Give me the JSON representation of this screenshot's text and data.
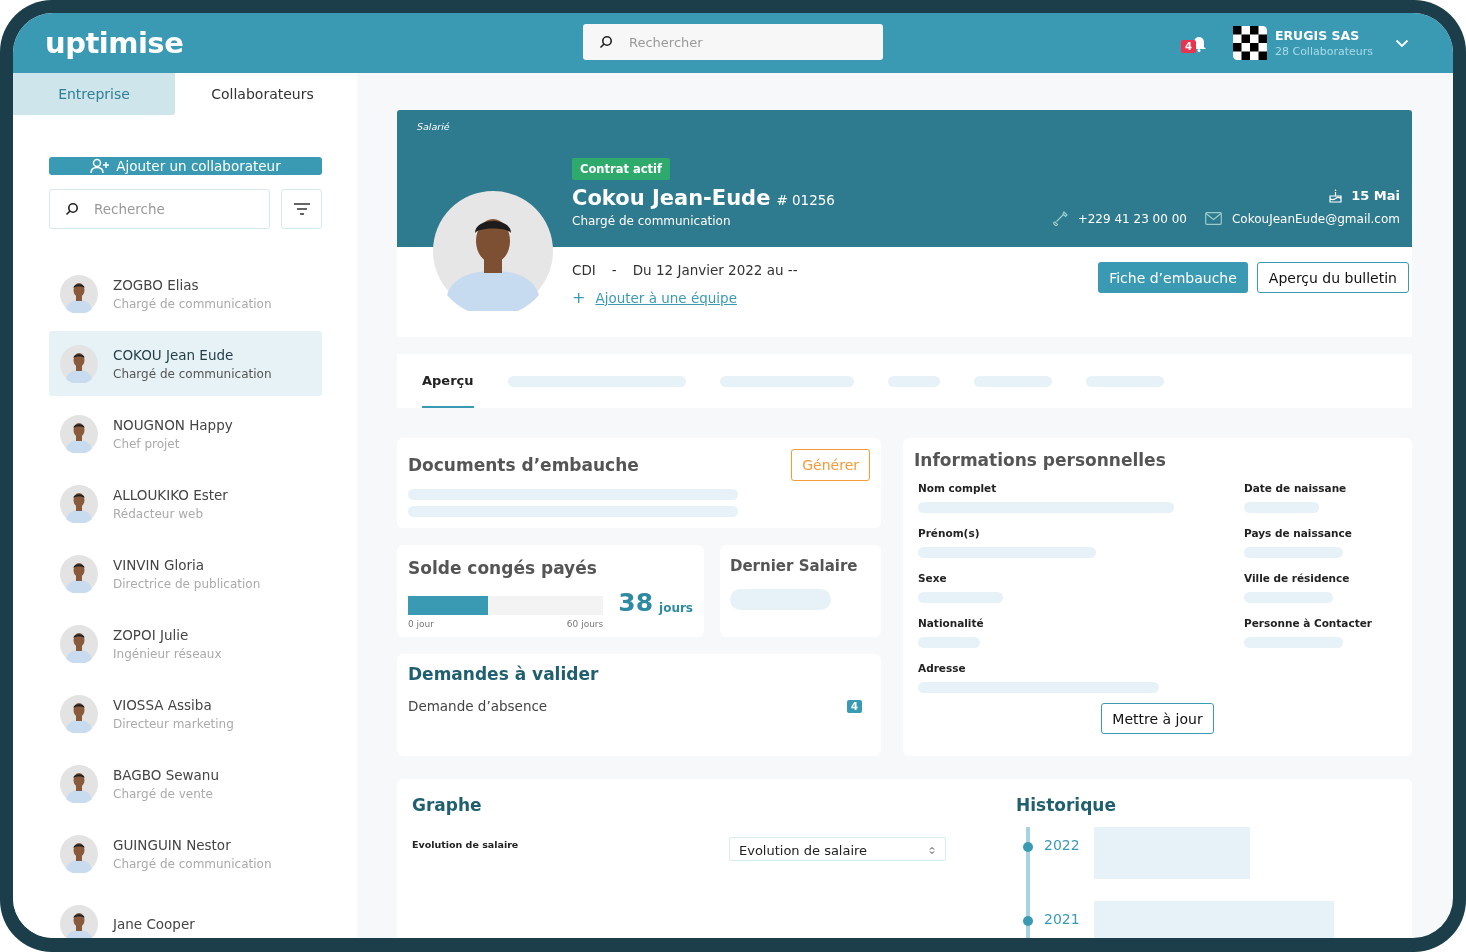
{
  "header": {
    "logo": "uptimise",
    "search": {
      "placeholder": "Rechercher"
    },
    "notifications": "4",
    "company": {
      "name": "ERUGIS SAS",
      "subtitle": "28 Collaborateurs"
    }
  },
  "sidebar": {
    "tabs": [
      {
        "label": "Entreprise",
        "selected": true
      },
      {
        "label": "Collaborateurs",
        "selected": false
      }
    ],
    "add_button": "Ajouter un collaborateur",
    "search": {
      "placeholder": "Recherche"
    },
    "employees": [
      {
        "name": "ZOGBO Elias",
        "role": "Chargé de communication",
        "selected": false
      },
      {
        "name": "COKOU Jean Eude",
        "role": "Chargé de communication",
        "selected": true
      },
      {
        "name": "NOUGNON Happy",
        "role": "Chef projet",
        "selected": false
      },
      {
        "name": "ALLOUKIKO Ester",
        "role": "Rédacteur web",
        "selected": false
      },
      {
        "name": "VINVIN Gloria",
        "role": "Directrice de publication",
        "selected": false
      },
      {
        "name": "ZOPOI Julie",
        "role": "Ingénieur réseaux",
        "selected": false
      },
      {
        "name": "VIOSSA Assiba",
        "role": "Directeur marketing",
        "selected": false
      },
      {
        "name": "BAGBO Sewanu",
        "role": "Chargé de vente",
        "selected": false
      },
      {
        "name": "GUINGUIN Nestor",
        "role": "Chargé de communication",
        "selected": false
      },
      {
        "name": "Jane Cooper",
        "selected": false
      }
    ]
  },
  "profile": {
    "status": "Salarié",
    "badge": "Contrat actif",
    "name": "Cokou Jean-Eude",
    "id": "# 01256",
    "role": "Chargé de communication",
    "birthday": "15 Mai",
    "phone": "+229 41 23 00 00",
    "email": "CokouJeanEude@gmail.com",
    "contract": "CDI",
    "separator": "-",
    "period": "Du 12 Janvier 2022 au --",
    "team_icon": "+",
    "team_link": "Ajouter à une équipe",
    "buttons": [
      "Fiche d’embauche",
      "Aperçu du bulletin"
    ]
  },
  "content_tabs": [
    {
      "label": "Aperçu",
      "selected": true
    }
  ],
  "documents": {
    "title": "Documents d’embauche",
    "button": "Générer"
  },
  "leave": {
    "title": "Solde congés payés",
    "level": 0.41,
    "min": "0 jour",
    "max": "60 jours",
    "value": "38",
    "unit": "jours"
  },
  "last_salary": {
    "title": "Dernier Salaire"
  },
  "requests": {
    "title": "Demandes à valider",
    "items": [
      {
        "label": "Demande d’absence",
        "count": "4"
      }
    ]
  },
  "personal_info": {
    "title": "Informations personnelles",
    "left_fields": [
      "Nom complet",
      "Prénom(s)",
      "Sexe",
      "Nationalité",
      "Adresse"
    ],
    "right_fields": [
      "Date de naissane",
      "Pays de naissance",
      "Ville de résidence",
      "Personne à Contacter"
    ],
    "button": "Mettre à jour"
  },
  "graph": {
    "title": "Graphe",
    "label": "Evolution de salaire",
    "select": "Evolution de salaire"
  },
  "history": {
    "title": "Historique",
    "years": [
      "2022",
      "2021"
    ]
  }
}
